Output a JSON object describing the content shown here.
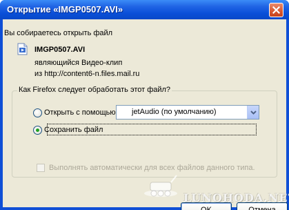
{
  "window": {
    "title": "Открытие «IMGP0507.AVI»",
    "close_glyph": "✕"
  },
  "dialog": {
    "intro": "Вы собираетесь открыть файл",
    "file_name": "IMGP0507.AVI",
    "file_type_line": "являющийся  Видео-клип",
    "source_line": "из http://content6-n.files.mail.ru",
    "file_icon": "video-file-icon"
  },
  "group": {
    "legend": "Как Firefox следует обработать этот файл?",
    "open_with_label": "Открыть с помощью",
    "open_with_selected": "jetAudio (по умолчанию)",
    "save_label": "Сохранить файл",
    "auto_label": "Выполнять автоматически для всех файлов данного типа.",
    "open_with_checked": false,
    "save_checked": true,
    "auto_checked": false,
    "auto_enabled": false
  },
  "buttons": {
    "ok": "OK",
    "cancel": "Отмена"
  },
  "watermark": {
    "text": "LUNOHODA.NET"
  },
  "colors": {
    "titlebar": "#0a4fd8",
    "dialog_bg": "#ece9d8",
    "radio_dot": "#21a121",
    "disabled_text": "#aca899"
  }
}
